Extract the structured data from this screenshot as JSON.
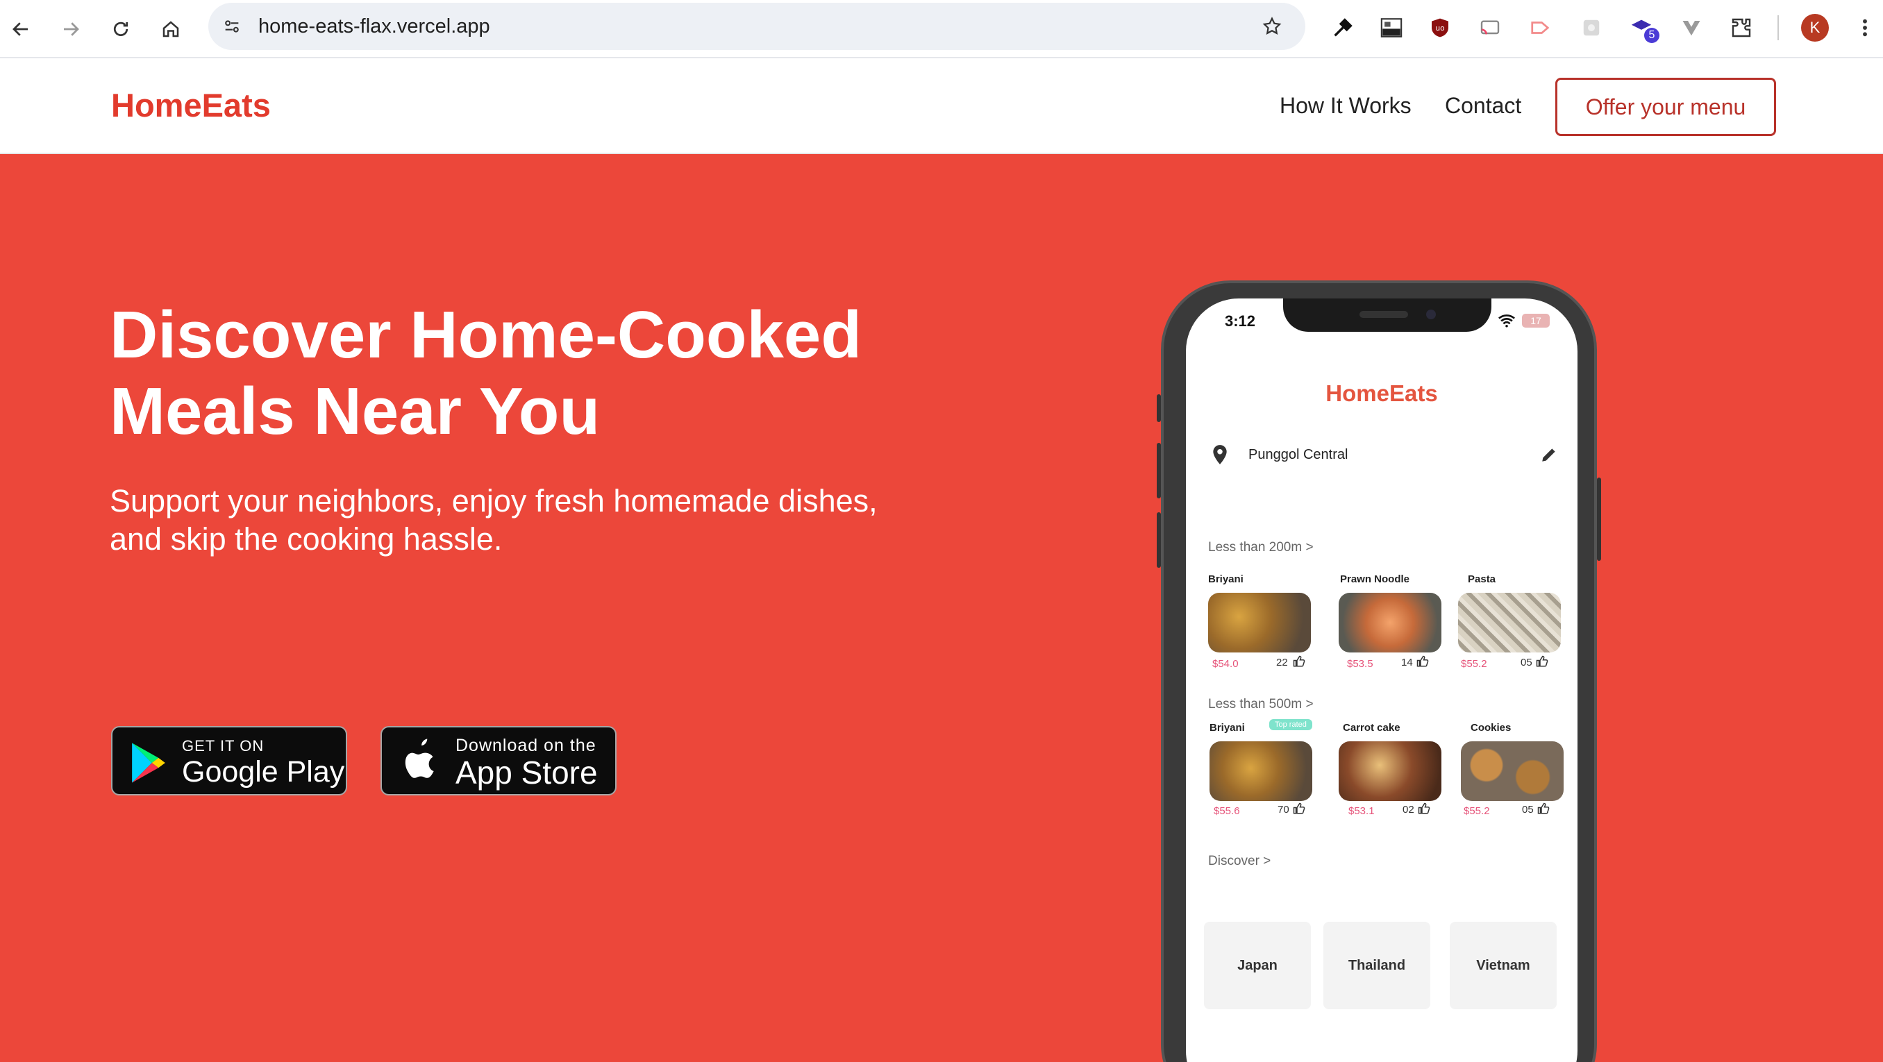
{
  "browser": {
    "url": "home-eats-flax.vercel.app",
    "extension_badge": "5",
    "profile_initial": "K"
  },
  "nav": {
    "logo": "HomeEats",
    "links": [
      "How It Works",
      "Contact"
    ],
    "cta": "Offer your menu"
  },
  "hero": {
    "headline_line1": "Discover Home-Cooked",
    "headline_line2": "Meals Near You",
    "subtitle_line1": "Support your neighbors, enjoy fresh homemade dishes,",
    "subtitle_line2": "and skip the cooking hassle.",
    "google_play": {
      "small": "GET IT ON",
      "big": "Google Play"
    },
    "app_store": {
      "small": "Download on the",
      "big": "App Store"
    }
  },
  "phone": {
    "time": "3:12",
    "battery": "17",
    "app_title": "HomeEats",
    "location": "Punggol Central",
    "section1": "Less than 200m >",
    "section1_items": [
      {
        "name": "Briyani",
        "price": "$54.0",
        "likes": "22"
      },
      {
        "name": "Prawn Noodle",
        "price": "$53.5",
        "likes": "14"
      },
      {
        "name": "Pasta",
        "price": "$55.2",
        "likes": "05"
      }
    ],
    "section2": "Less than 500m >",
    "top_rated_badge": "Top rated",
    "section2_items": [
      {
        "name": "Briyani",
        "price": "$55.6",
        "likes": "70"
      },
      {
        "name": "Carrot cake",
        "price": "$53.1",
        "likes": "02"
      },
      {
        "name": "Cookies",
        "price": "$55.2",
        "likes": "05"
      }
    ],
    "discover": "Discover >",
    "countries": [
      "Japan",
      "Thailand",
      "Vietnam"
    ]
  },
  "colors": {
    "brand_red": "#e23b2d",
    "hero_bg": "#ec473a",
    "cta_border": "#b8322a",
    "price_pink": "#e6547a"
  }
}
